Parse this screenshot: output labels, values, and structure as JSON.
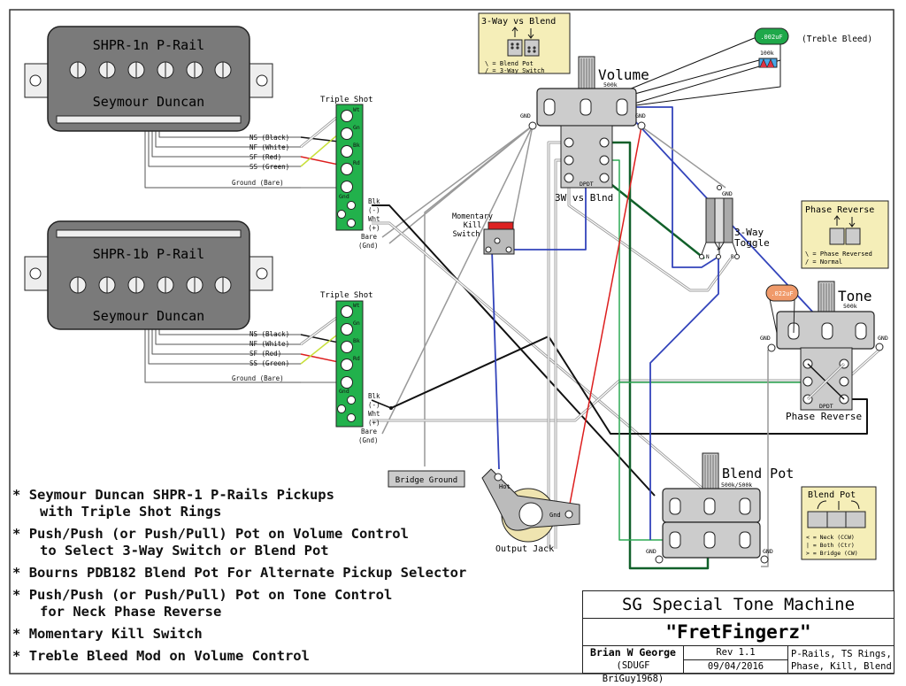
{
  "diagram": {
    "pickups": [
      {
        "model": "SHPR-1n P-Rail",
        "brand": "Seymour Duncan",
        "leads": [
          "NS (Black)",
          "NF (White)",
          "SF (Red)",
          "SS (Green)",
          "Ground (Bare)"
        ]
      },
      {
        "model": "SHPR-1b P-Rail",
        "brand": "Seymour Duncan",
        "leads": [
          "NS (Black)",
          "NF (White)",
          "SF (Red)",
          "SS (Green)",
          "Ground (Bare)"
        ]
      }
    ],
    "triple_shot": {
      "title": "Triple Shot",
      "pads": [
        "Wt",
        "Gn",
        "Bk",
        "Rd",
        "Gnd"
      ],
      "outputs": [
        "Blk",
        "(-)",
        "Wht",
        "(+)",
        "Bare",
        "(Gnd)"
      ]
    },
    "volume": {
      "label": "Volume",
      "value": "500k",
      "gnd": "GND"
    },
    "treble_bleed": {
      "cap": ".002uF",
      "resistor": "100k",
      "label": "(Treble Bleed)"
    },
    "legend_3way_blend": {
      "title": "3-Way vs Blend",
      "lines": [
        "\\ = Blend Pot",
        "/ = 3-Way Switch"
      ]
    },
    "dpdt_volume": {
      "label": "3W vs Blnd",
      "tag": "DPDT"
    },
    "kill_switch": {
      "label": [
        "Momentary",
        "Kill",
        "Switch"
      ]
    },
    "toggle": {
      "label": [
        "3-Way",
        "Toggle"
      ],
      "gnd": "GND",
      "pins": [
        "N",
        "+",
        "B"
      ]
    },
    "legend_phase": {
      "title": "Phase Reverse",
      "lines": [
        "\\ = Phase Reversed",
        "/ = Normal"
      ]
    },
    "tone": {
      "label": "Tone",
      "value": "500k",
      "cap": ".022uF",
      "gnd": "GND"
    },
    "dpdt_tone": {
      "label": "Phase Reverse",
      "tag": "DPDT"
    },
    "bridge_ground": {
      "label": "Bridge Ground"
    },
    "output_jack": {
      "label": "Output Jack",
      "hot": "Hot",
      "gnd": "Gnd"
    },
    "blend_pot": {
      "label": "Blend Pot",
      "value": "500k/500k",
      "gnd": "GND"
    },
    "legend_blend": {
      "title": "Blend Pot",
      "lines": [
        "< = Neck (CCW)",
        "| = Both (Ctr)",
        "> = Bridge (CW)"
      ]
    },
    "colors": {
      "pickup_body": "#7a7a7a",
      "triple_shot": "#22b14c",
      "legend_bg": "#f5eeb8",
      "wire_blue": "#3344bb",
      "wire_green": "#2faa55",
      "wire_dkgreen": "#11602a",
      "wire_red": "#dd1e1e",
      "wire_yellow": "#c8e03a",
      "cap_green": "#1fa84a",
      "cap_orange": "#f09a6a",
      "jack_ring": "#efe4b0"
    }
  },
  "notes": [
    {
      "line": "Seymour Duncan SHPR-1 P-Rails Pickups",
      "sub": "with Triple Shot Rings"
    },
    {
      "line": "Push/Push (or Push/Pull) Pot on Volume Control",
      "sub": "to Select 3-Way Switch or Blend Pot"
    },
    {
      "line": "Bourns PDB182 Blend Pot For Alternate Pickup Selector",
      "sub": ""
    },
    {
      "line": "Push/Push (or Push/Pull) Pot on Tone Control",
      "sub": "for Neck Phase Reverse"
    },
    {
      "line": "Momentary Kill Switch",
      "sub": ""
    },
    {
      "line": "Treble Bleed Mod on Volume Control",
      "sub": ""
    }
  ],
  "note_bullet": "*",
  "title_block": {
    "title": "SG Special Tone Machine",
    "name": "\"FretFingerz\"",
    "author": "Brian W George",
    "handle": "(SDUGF BriGuy1968)",
    "rev": "Rev 1.1",
    "date": "09/04/2016",
    "desc1": "P-Rails, TS Rings,",
    "desc2": "Phase, Kill, Blend"
  }
}
